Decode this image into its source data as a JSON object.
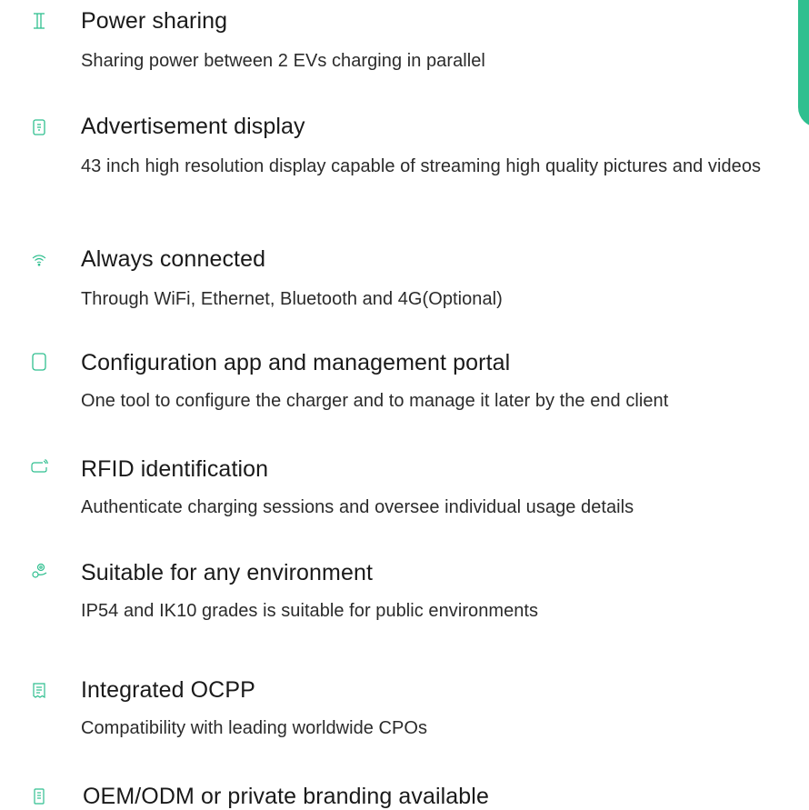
{
  "accent_color": "#2fbf8f",
  "features": [
    {
      "icon": "power-sharing-icon",
      "title": "Power sharing",
      "description": "Sharing power between 2 EVs charging in parallel"
    },
    {
      "icon": "display-icon",
      "title": "Advertisement display",
      "description": "43 inch high resolution display capable of streaming high quality pictures and videos"
    },
    {
      "icon": "wifi-icon",
      "title": "Always connected",
      "description": "Through WiFi, Ethernet, Bluetooth and 4G(Optional)"
    },
    {
      "icon": "phone-icon",
      "title": "Configuration app and management portal",
      "description": "One tool to configure the charger and to manage it later by the end client"
    },
    {
      "icon": "rfid-card-icon",
      "title": "RFID identification",
      "description": "Authenticate charging sessions and oversee individual usage details"
    },
    {
      "icon": "environment-icon",
      "title": "Suitable for any environment",
      "description": "IP54 and IK10 grades is suitable for public environments"
    },
    {
      "icon": "ocpp-receipt-icon",
      "title": "Integrated OCPP",
      "description": "Compatibility with leading worldwide CPOs"
    },
    {
      "icon": "branding-icon",
      "title": "OEM/ODM or private branding available",
      "description": ""
    }
  ]
}
